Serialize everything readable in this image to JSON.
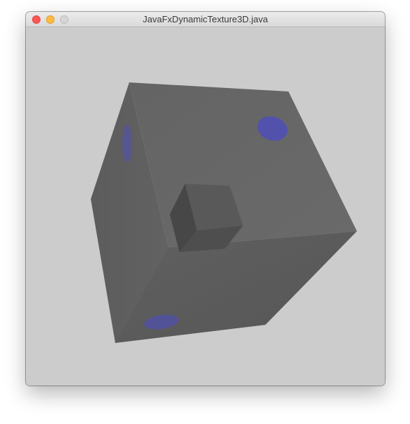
{
  "window": {
    "title": "JavaFxDynamicTexture3D.java"
  },
  "colors": {
    "scene_background": "#cccccc",
    "cube_face": "#626262",
    "texture_dot": "#4f4fb8"
  },
  "icons": [
    "close-icon",
    "minimize-icon",
    "zoom-icon"
  ]
}
